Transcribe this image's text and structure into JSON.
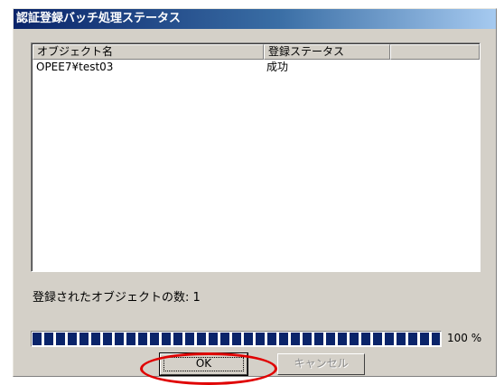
{
  "window": {
    "title": "認証登録バッチ処理ステータス"
  },
  "list": {
    "columns": [
      "オブジェクト名",
      "登録ステータス",
      ""
    ],
    "rows": [
      {
        "object": "OPEE7¥test03",
        "status": "成功"
      }
    ]
  },
  "summary": {
    "count_label": "登録されたオブジェクトの数: 1"
  },
  "progress": {
    "value": 100,
    "label": "100 %"
  },
  "buttons": {
    "ok": "OK",
    "cancel": "キャンセル"
  },
  "annotation": {
    "color": "#e00000"
  }
}
